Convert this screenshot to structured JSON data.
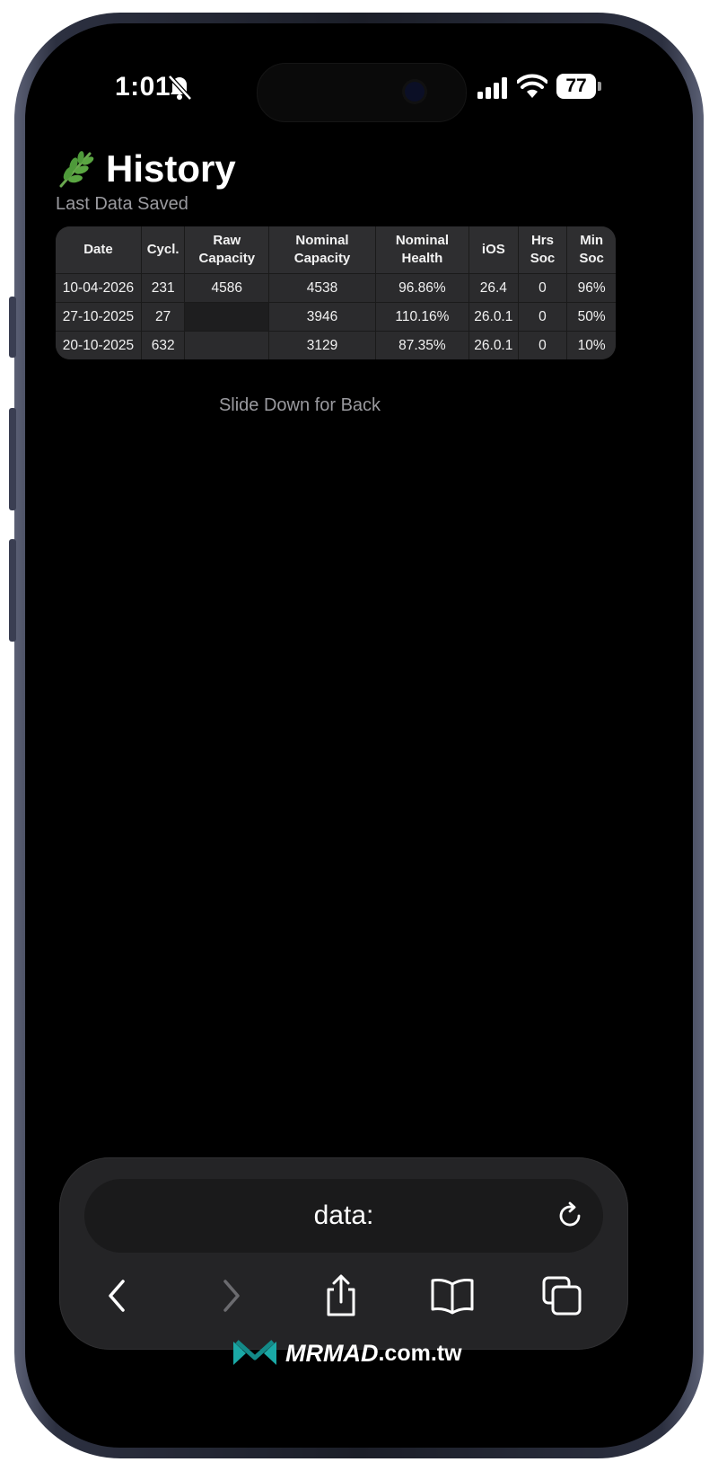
{
  "status_bar": {
    "time": "1:01",
    "battery": "77"
  },
  "page": {
    "title": "History",
    "subtitle": "Last Data Saved",
    "hint": "Slide Down for Back"
  },
  "table": {
    "headers": [
      [
        "Date",
        ""
      ],
      [
        "Cycl.",
        ""
      ],
      [
        "Raw",
        "Capacity"
      ],
      [
        "Nominal",
        "Capacity"
      ],
      [
        "Nominal",
        "Health"
      ],
      [
        "iOS",
        ""
      ],
      [
        "Hrs",
        "Soc"
      ],
      [
        "Min",
        "Soc"
      ]
    ],
    "rows": [
      [
        "10-04-2026",
        "231",
        "4586",
        "4538",
        "96.86%",
        "26.4",
        "0",
        "96%"
      ],
      [
        "27-10-2025",
        "27",
        "",
        "3946",
        "110.16%",
        "26.0.1",
        "0",
        "50%"
      ],
      [
        "20-10-2025",
        "632",
        "",
        "3129",
        "87.35%",
        "26.0.1",
        "0",
        "10%"
      ]
    ]
  },
  "browser": {
    "url": "data:",
    "toolbar": [
      "back-icon",
      "forward-icon",
      "share-icon",
      "bookmarks-icon",
      "tabs-icon"
    ]
  },
  "watermark": {
    "brand": "MRMAD",
    "domain": ".com.tw"
  },
  "colors": {
    "background": "#000000",
    "accent": "#1aa9a6",
    "leaf": "#4e9a3a"
  }
}
